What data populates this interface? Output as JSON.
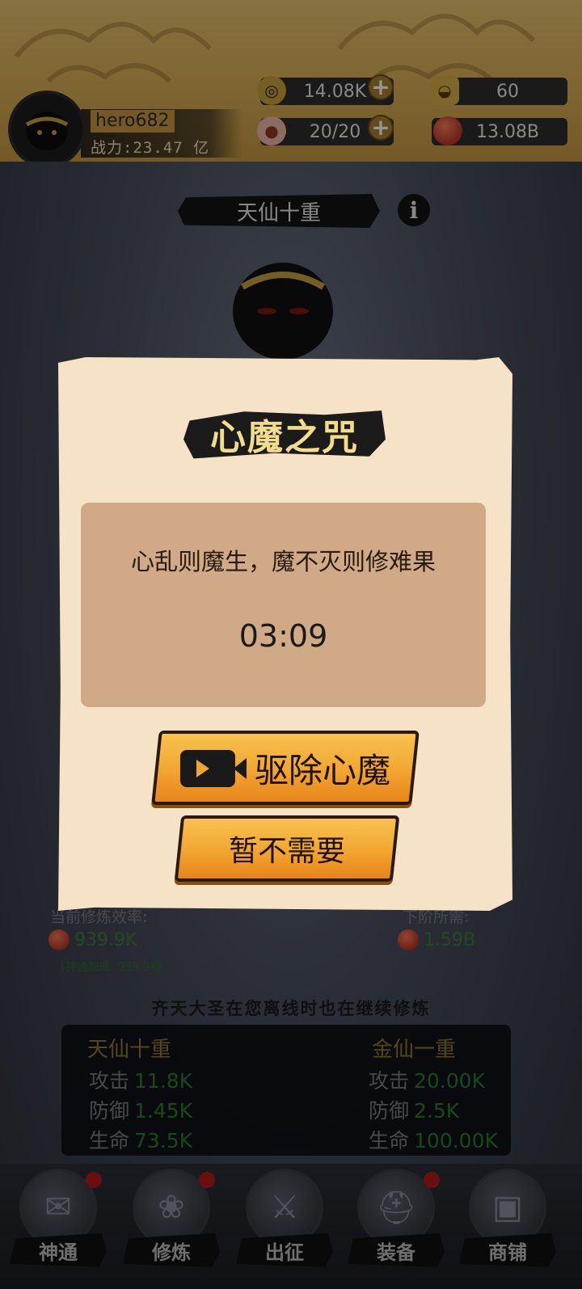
{
  "player": {
    "name": "hero682",
    "power_label": "战力:23.47 亿"
  },
  "resources": {
    "coins": "14.08K",
    "ingots": "60",
    "peaches": "20/20",
    "essence": "13.08B"
  },
  "realm": {
    "banner": "天仙十重",
    "info_icon": "i"
  },
  "efficiency": {
    "current_label": "当前修炼效率:",
    "current_value": "939.9K",
    "bonus": "(神通加成: 939.9K)",
    "next_label": "下阶所需:",
    "next_value": "1.59B"
  },
  "offline_text": "齐天大圣在您离线时也在继续修炼",
  "stats": {
    "current": {
      "title": "天仙十重",
      "rows": [
        {
          "label": "攻击",
          "value": "11.8K"
        },
        {
          "label": "防御",
          "value": "1.45K"
        },
        {
          "label": "生命",
          "value": "73.5K"
        }
      ]
    },
    "next": {
      "title": "金仙一重",
      "rows": [
        {
          "label": "攻击",
          "value": "20.00K"
        },
        {
          "label": "防御",
          "value": "2.5K"
        },
        {
          "label": "生命",
          "value": "100.00K"
        }
      ]
    }
  },
  "nav": [
    {
      "label": "神通",
      "icon": "scroll-icon",
      "badge": true
    },
    {
      "label": "修炼",
      "icon": "lotus-icon",
      "badge": true
    },
    {
      "label": "出征",
      "icon": "sword-icon",
      "badge": false
    },
    {
      "label": "装备",
      "icon": "helmet-icon",
      "badge": true
    },
    {
      "label": "商铺",
      "icon": "chest-icon",
      "badge": false
    }
  ],
  "modal": {
    "title": "心魔之咒",
    "message": "心乱则魔生，魔不灭则修难果",
    "countdown": "03:09",
    "primary_button": "驱除心魔",
    "secondary_button": "暂不需要"
  },
  "colors": {
    "header_gold": "#e9c46f",
    "modal_paper": "#f6e2c6",
    "message_box": "#d0a987",
    "button_orange": "#f2a531",
    "stat_green": "#2e7d32",
    "title_gold": "#f3dc8b"
  }
}
